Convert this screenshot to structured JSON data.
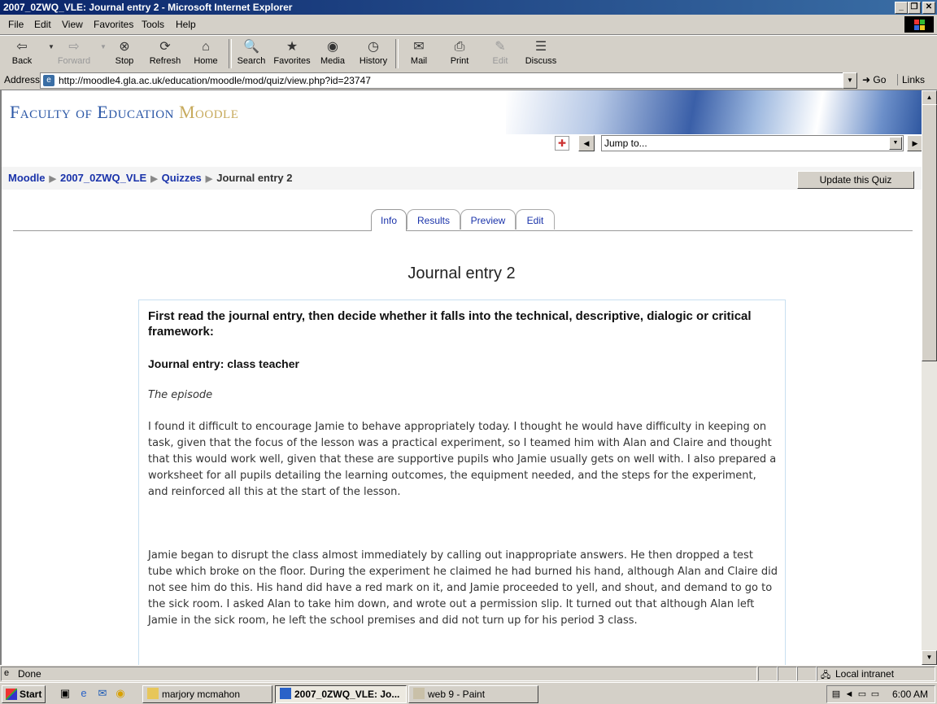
{
  "window": {
    "title": "2007_0ZWQ_VLE: Journal entry 2 - Microsoft Internet Explorer"
  },
  "menu": [
    "File",
    "Edit",
    "View",
    "Favorites",
    "Tools",
    "Help"
  ],
  "toolbar": {
    "back": "Back",
    "forward": "Forward",
    "stop": "Stop",
    "refresh": "Refresh",
    "home": "Home",
    "search": "Search",
    "favorites": "Favorites",
    "media": "Media",
    "history": "History",
    "mail": "Mail",
    "print": "Print",
    "edit": "Edit",
    "discuss": "Discuss"
  },
  "address": {
    "label": "Address",
    "url": "http://moodle4.gla.ac.uk/education/moodle/mod/quiz/view.php?id=23747",
    "go": "Go",
    "links": "Links"
  },
  "site": {
    "title_part1": "Faculty of Education ",
    "title_part2": "Moodle",
    "jump_to": "Jump to..."
  },
  "breadcrumb": {
    "home": "Moodle",
    "course": "2007_0ZWQ_VLE",
    "section": "Quizzes",
    "current": "Journal entry 2"
  },
  "update_button": "Update this Quiz",
  "tabs": [
    "Info",
    "Results",
    "Preview",
    "Edit"
  ],
  "page_title": "Journal entry 2",
  "question": {
    "heading": "First read the journal entry, then decide whether it falls into the technical, descriptive, dialogic or critical framework:",
    "subheading": "Journal entry: class teacher",
    "episode": "The episode",
    "para1": "I found it difficult to encourage Jamie to behave appropriately today. I thought he would have difficulty in keeping on task, given that the focus of the lesson was a practical experiment, so I teamed him with Alan and Claire and thought that this would work well, given that these are supportive pupils who Jamie usually gets on well with. I also prepared a worksheet for all pupils detailing the learning outcomes, the equipment needed, and the steps for the experiment, and reinforced all this at the start of the lesson.",
    "para2": "Jamie began to disrupt the class almost immediately by calling out inappropriate answers. He then dropped a test tube which broke on the floor. During the experiment he claimed he had burned his hand, although Alan and Claire did not see him do this. His hand did have a red mark on it, and Jamie proceeded to yell, and shout, and demand to go to the sick room. I asked Alan to take him down, and wrote out a permission slip. It turned out that although Alan left Jamie in the sick room, he left the school premises and did not turn up for his period 3 class."
  },
  "status": {
    "text": "Done",
    "zone": "Local intranet"
  },
  "taskbar": {
    "start": "Start",
    "tasks": [
      "marjory mcmahon",
      "2007_0ZWQ_VLE: Jo...",
      "web 9 - Paint"
    ],
    "clock": "6:00 AM"
  }
}
